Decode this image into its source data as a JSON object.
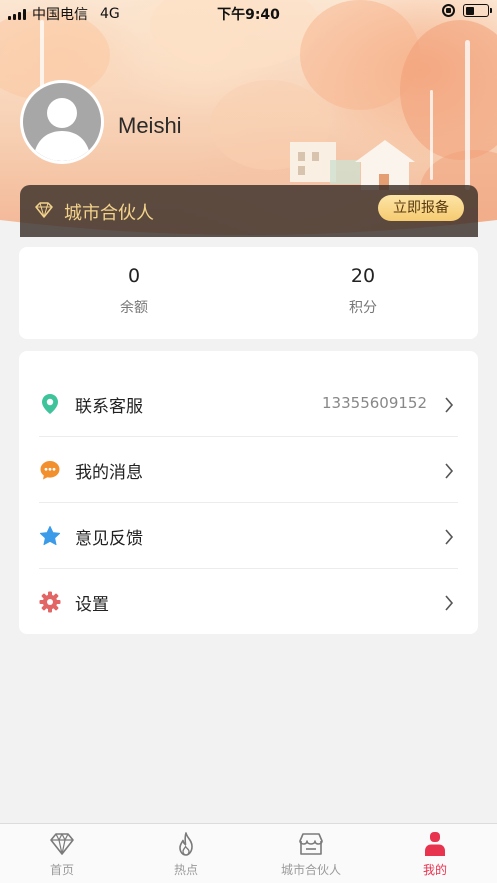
{
  "status_bar": {
    "carrier": "中国电信",
    "network": "4G",
    "time": "下午9:40",
    "battery_level": 0.4
  },
  "profile": {
    "username": "Meishi",
    "avatar_icon": "default-user-avatar"
  },
  "partner_banner": {
    "label": "城市合伙人",
    "button_label": "立即报备",
    "label_color": "#f3d38b",
    "button_color": "#f6cb71"
  },
  "stats": [
    {
      "value": "0",
      "label": "余额"
    },
    {
      "value": "20",
      "label": "积分"
    }
  ],
  "menu": [
    {
      "label": "联系客服",
      "value": "13355609152",
      "icon": "location-pin-icon",
      "color": "#3fc39b"
    },
    {
      "label": "我的消息",
      "value": "",
      "icon": "message-bubble-icon",
      "color": "#f2902d"
    },
    {
      "label": "意见反馈",
      "value": "",
      "icon": "star-icon",
      "color": "#3b9be8"
    },
    {
      "label": "设置",
      "value": "",
      "icon": "gear-icon",
      "color": "#e26666"
    }
  ],
  "tabbar": {
    "active_color": "#e8334f",
    "items": [
      {
        "label": "首页",
        "icon": "diamond-icon",
        "active": false
      },
      {
        "label": "热点",
        "icon": "flame-icon",
        "active": false
      },
      {
        "label": "城市合伙人",
        "icon": "shop-icon",
        "active": false
      },
      {
        "label": "我的",
        "icon": "user-icon",
        "active": true
      }
    ]
  }
}
